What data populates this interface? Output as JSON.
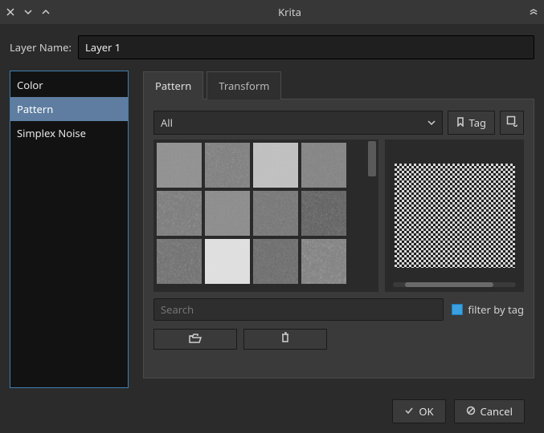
{
  "title": "Krita",
  "layer": {
    "label": "Layer Name:",
    "value": "Layer 1"
  },
  "generators": {
    "items": [
      {
        "label": "Color"
      },
      {
        "label": "Pattern"
      },
      {
        "label": "Simplex Noise"
      }
    ],
    "selected_index": 1
  },
  "tabs": {
    "items": [
      {
        "label": "Pattern"
      },
      {
        "label": "Transform"
      }
    ],
    "active_index": 0
  },
  "tag_filter": {
    "selected": "All"
  },
  "tag_button": "Tag",
  "search": {
    "placeholder": "Search",
    "value": ""
  },
  "filter_checkbox": {
    "label": "filter by tag",
    "checked": true
  },
  "footer": {
    "ok": "OK",
    "cancel": "Cancel"
  }
}
